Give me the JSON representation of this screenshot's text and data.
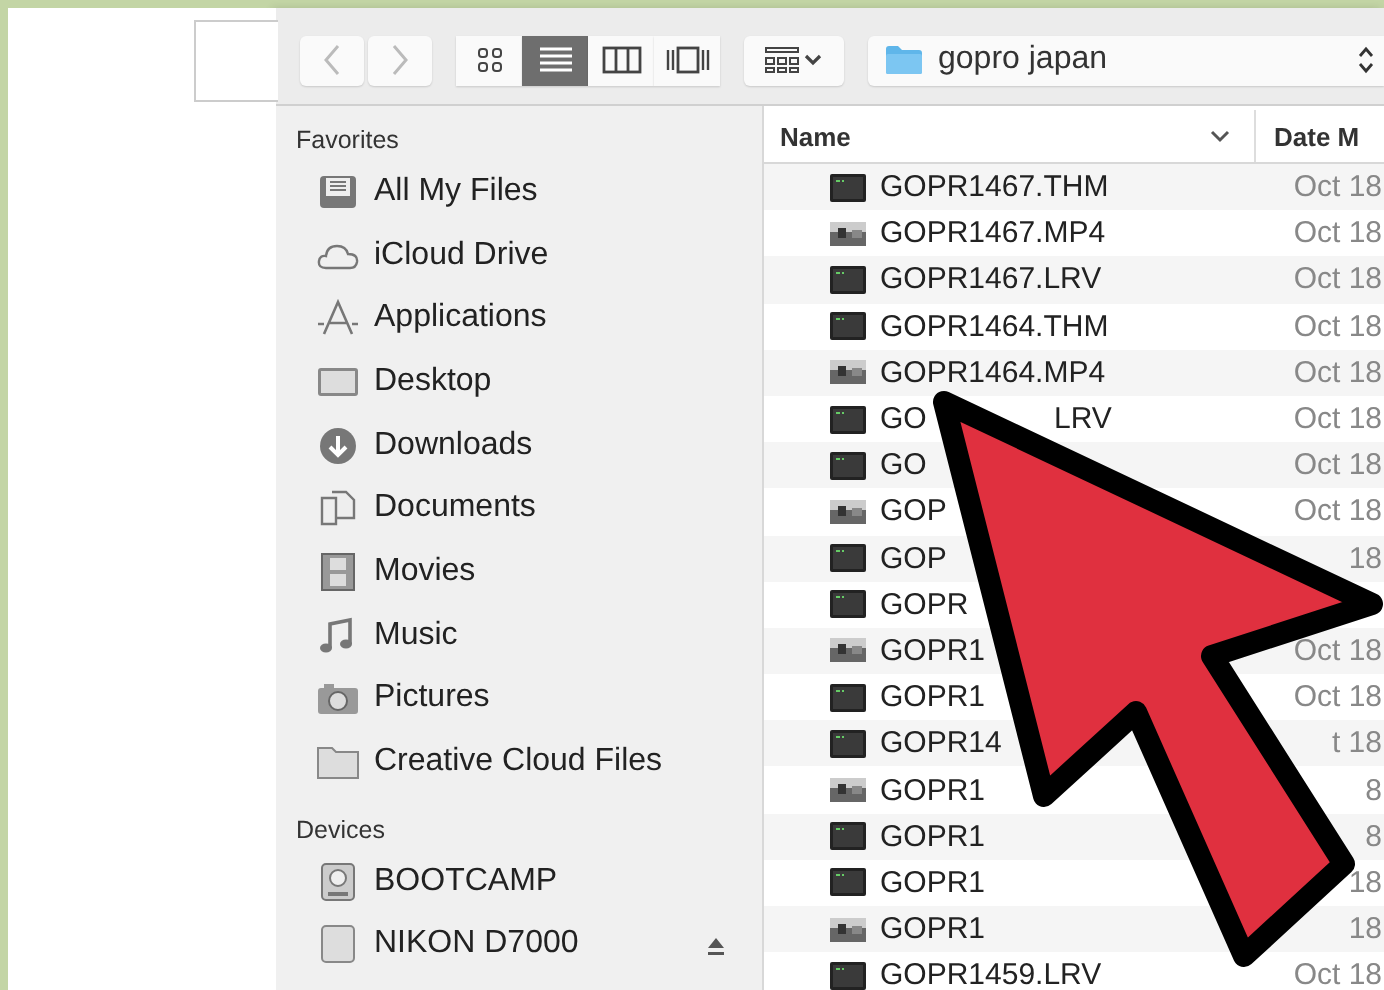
{
  "toolbar": {
    "location": "gopro japan",
    "view_modes": [
      {
        "kind": "icons",
        "selected": false
      },
      {
        "kind": "list",
        "selected": true
      },
      {
        "kind": "columns",
        "selected": false
      },
      {
        "kind": "coverflow",
        "selected": false
      }
    ]
  },
  "sidebar": {
    "sections": [
      {
        "title": "Favorites",
        "items": [
          {
            "label": "All My Files",
            "kind": "allfiles"
          },
          {
            "label": "iCloud Drive",
            "kind": "cloud"
          },
          {
            "label": "Applications",
            "kind": "apps"
          },
          {
            "label": "Desktop",
            "kind": "desktop"
          },
          {
            "label": "Downloads",
            "kind": "downloads"
          },
          {
            "label": "Documents",
            "kind": "documents"
          },
          {
            "label": "Movies",
            "kind": "movies"
          },
          {
            "label": "Music",
            "kind": "music"
          },
          {
            "label": "Pictures",
            "kind": "pictures"
          },
          {
            "label": "Creative Cloud Files",
            "kind": "folder"
          }
        ]
      },
      {
        "title": "Devices",
        "items": [
          {
            "label": "BOOTCAMP",
            "kind": "disk"
          },
          {
            "label": "NIKON D7000",
            "kind": "drive",
            "ejectable": true
          }
        ]
      }
    ]
  },
  "file_list": {
    "columns": [
      "Name",
      "Date M"
    ],
    "rows": [
      {
        "name": "GOPR1467.THM",
        "kind": "thm",
        "date": "Oct 18"
      },
      {
        "name": "GOPR1467.MP4",
        "kind": "mp4",
        "date": "Oct 18"
      },
      {
        "name": "GOPR1467.LRV",
        "kind": "thm",
        "date": "Oct 18"
      },
      {
        "name": "GOPR1464.THM",
        "kind": "thm",
        "date": "Oct 18"
      },
      {
        "name": "GOPR1464.MP4",
        "kind": "mp4",
        "date": "Oct 18"
      },
      {
        "name": "GO",
        "tail": "LRV",
        "kind": "thm",
        "date": "Oct 18"
      },
      {
        "name": "GO",
        "kind": "thm",
        "date": "Oct 18"
      },
      {
        "name": "GOP",
        "kind": "mp4",
        "date": "Oct 18"
      },
      {
        "name": "GOP",
        "kind": "thm",
        "date": "18"
      },
      {
        "name": "GOPR",
        "kind": "thm"
      },
      {
        "name": "GOPR1",
        "kind": "mp4",
        "date": "Oct 18"
      },
      {
        "name": "GOPR1",
        "kind": "thm",
        "date": "Oct 18"
      },
      {
        "name": "GOPR14",
        "kind": "thm",
        "date": "t 18"
      },
      {
        "name": "GOPR1",
        "kind": "mp4",
        "date": "8"
      },
      {
        "name": "GOPR1",
        "kind": "thm",
        "date": "8"
      },
      {
        "name": "GOPR1",
        "kind": "thm",
        "date": "18"
      },
      {
        "name": "GOPR1",
        "kind": "mp4",
        "date": "18"
      },
      {
        "name": "GOPR1459.LRV",
        "kind": "thm",
        "date": "Oct 18"
      }
    ]
  }
}
